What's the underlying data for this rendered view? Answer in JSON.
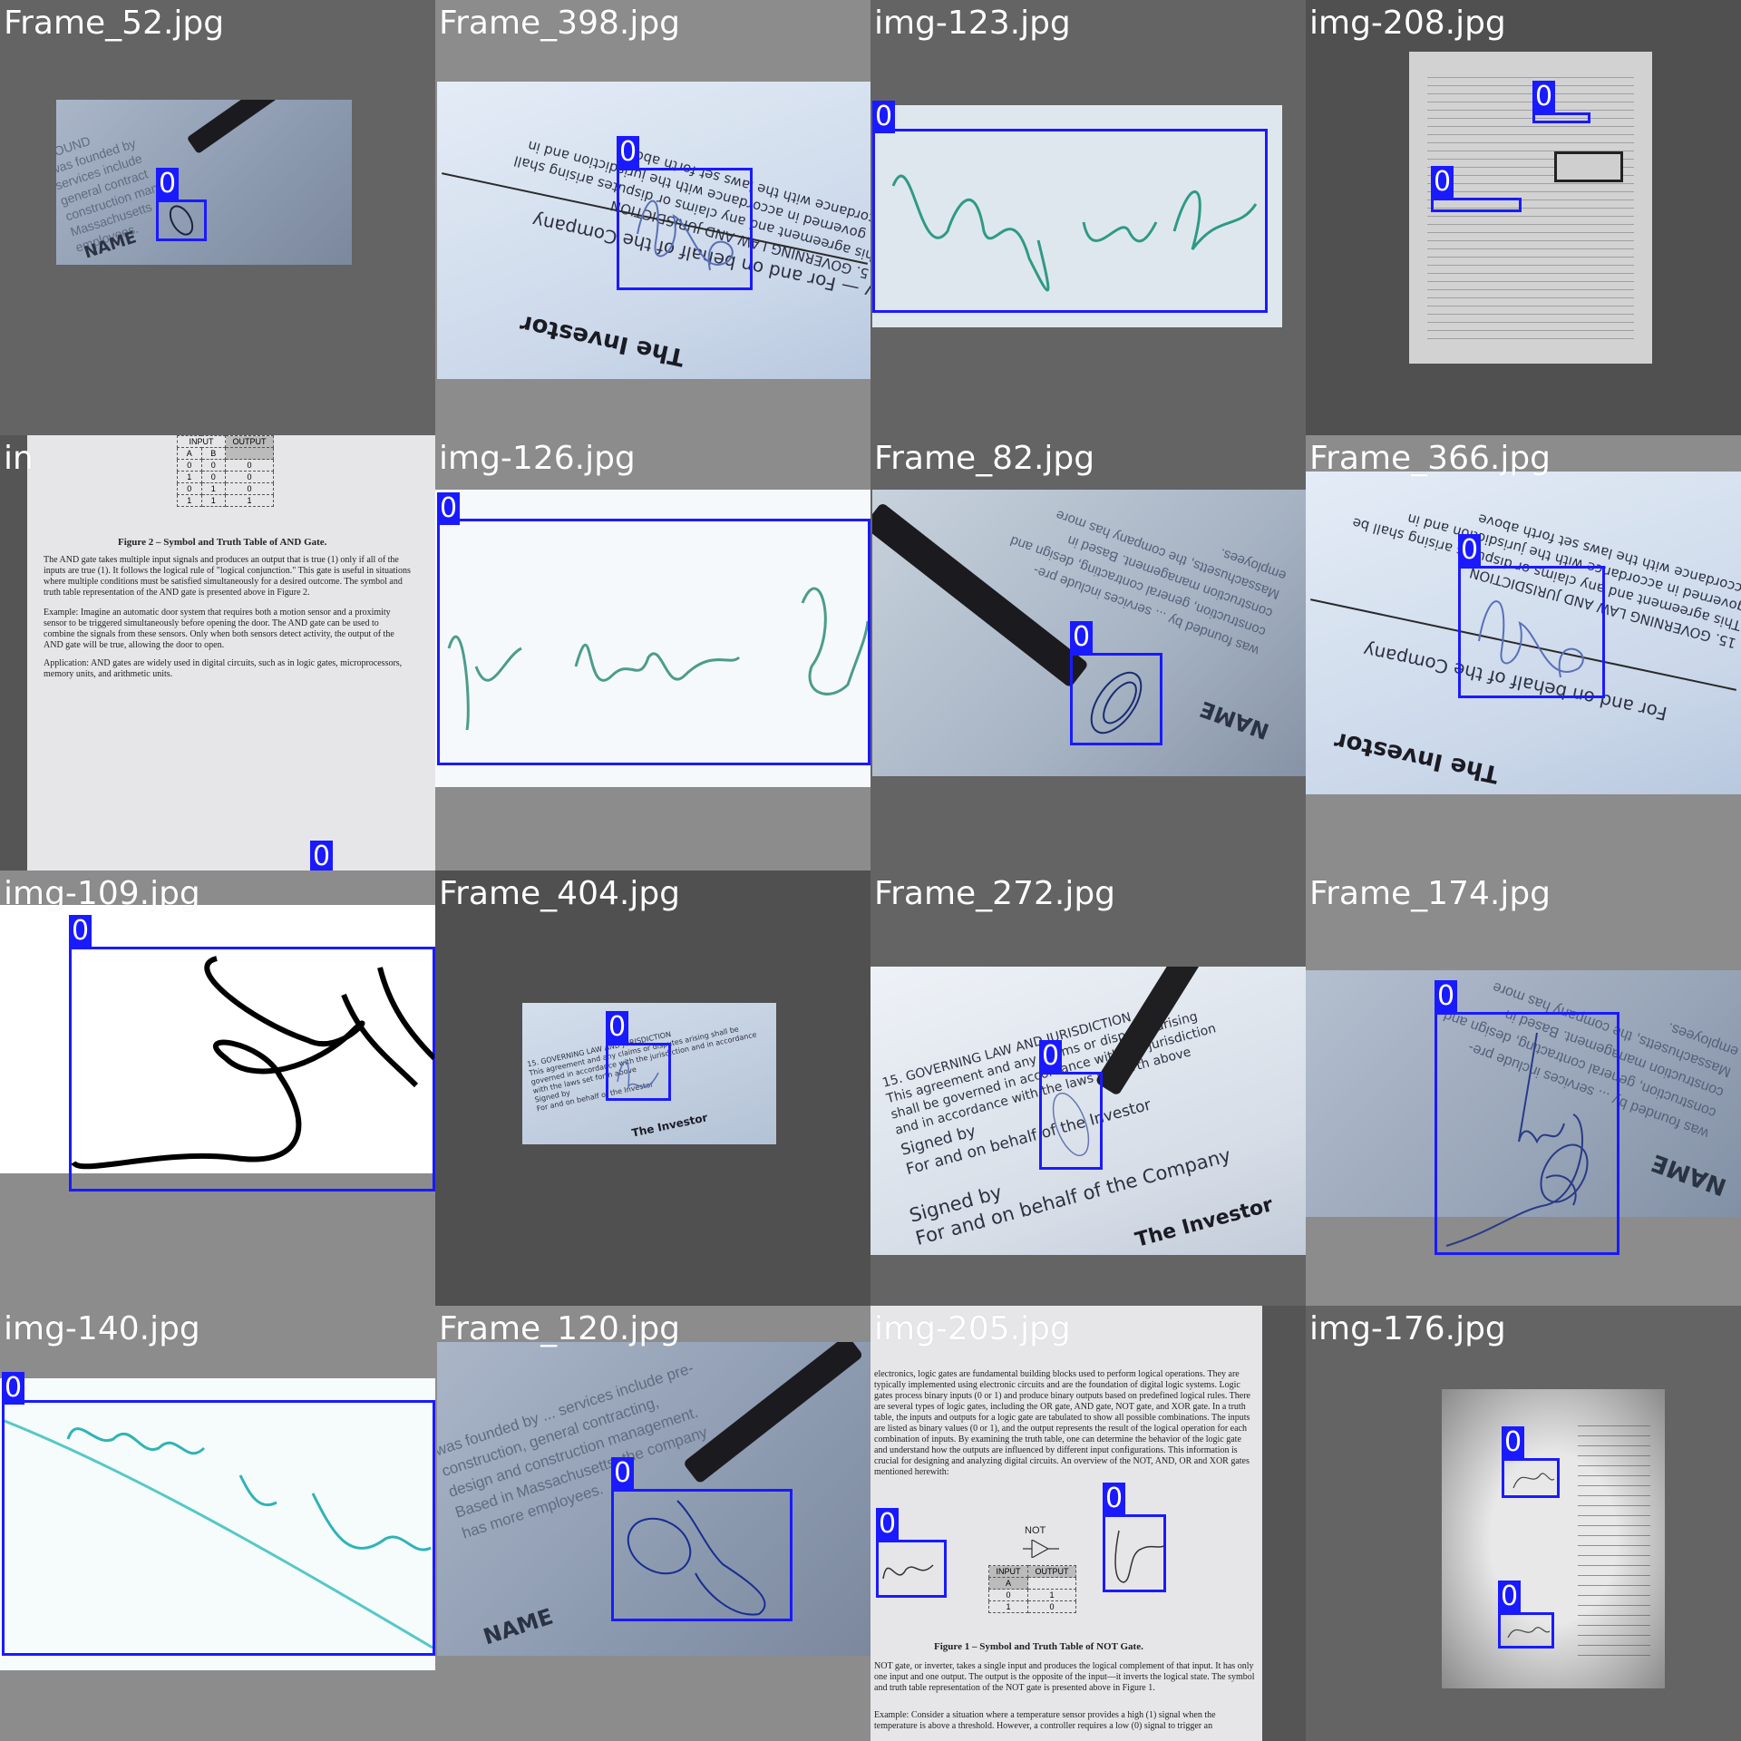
{
  "grid": {
    "tiles": [
      {
        "file": "Frame_52.jpg",
        "label": "0"
      },
      {
        "file": "Frame_398.jpg",
        "label": "0"
      },
      {
        "file": "img-123.jpg",
        "label": "0"
      },
      {
        "file": "img-208.jpg",
        "label": "0"
      },
      {
        "file": "img-xxx",
        "label": "0"
      },
      {
        "file": "img-126.jpg",
        "label": "0"
      },
      {
        "file": "Frame_82.jpg",
        "label": "0"
      },
      {
        "file": "Frame_366.jpg",
        "label": "0"
      },
      {
        "file": "img-109.jpg",
        "label": "0"
      },
      {
        "file": "Frame_404.jpg",
        "label": "0"
      },
      {
        "file": "Frame_272.jpg",
        "label": "0"
      },
      {
        "file": "Frame_174.jpg",
        "label": "0"
      },
      {
        "file": "img-140.jpg",
        "label": "0"
      },
      {
        "file": "Frame_120.jpg",
        "label": "0"
      },
      {
        "file": "img-205.jpg",
        "label": "0"
      },
      {
        "file": "img-176.jpg",
        "label": "0"
      }
    ]
  },
  "tile5": {
    "title": "in"
  },
  "doc5": {
    "table_headers": [
      "INPUT",
      "OUTPUT"
    ],
    "table_sub": [
      "A",
      "B"
    ],
    "rows": [
      [
        "0",
        "0",
        "0"
      ],
      [
        "1",
        "0",
        "0"
      ],
      [
        "0",
        "1",
        "0"
      ],
      [
        "1",
        "1",
        "1"
      ]
    ],
    "caption": "Figure 2 – Symbol and Truth Table of AND Gate.",
    "para1": "The AND gate takes multiple input signals and produces an output that is true (1) only if all of the inputs are true (1). It follows the logical rule of \"logical conjunction.\" This gate is useful in situations where multiple conditions must be satisfied simultaneously for a desired outcome. The symbol and truth table representation of the AND gate is presented above in Figure 2.",
    "para2": "Example: Imagine an automatic door system that requires both a motion sensor and a proximity sensor to be triggered simultaneously before opening the door. The AND gate can be used to combine the signals from these sensors. Only when both sensors detect activity, the output of the AND gate will be true, allowing the door to open.",
    "para3": "Application: AND gates are widely used in digital circuits, such as in logic gates, microprocessors, memory units, and arithmetic units."
  },
  "doc15": {
    "para1": "electronics, logic gates are fundamental building blocks used to perform logical operations. They are typically implemented using electronic circuits and are the foundation of digital logic systems. Logic gates process binary inputs (0 or 1) and produce binary outputs based on predefined logical rules. There are several types of logic gates, including the OR gate, AND gate, NOT gate, and XOR gate. In a truth table, the inputs and outputs for a logic gate are tabulated to show all possible combinations. The inputs are listed as binary values (0 or 1), and the output represents the result of the logical operation for each combination of inputs. By examining the truth table, one can determine the behavior of the logic gate and understand how the outputs are influenced by different input configurations. This information is crucial for designing and analyzing digital circuits. An overview of the NOT, AND, OR and XOR gates mentioned herewith:",
    "gate": "NOT",
    "table_headers": [
      "INPUT",
      "OUTPUT"
    ],
    "table_sub": [
      "A"
    ],
    "rows": [
      [
        "0",
        "1"
      ],
      [
        "1",
        "0"
      ]
    ],
    "caption": "Figure 1 – Symbol and Truth Table of NOT Gate.",
    "para2": "NOT gate, or inverter, takes a single input and produces the logical complement of that input. It has only one input and one output. The output is the opposite of the input—it inverts the logical state. The symbol and truth table representation of the NOT gate is presented above in Figure 1.",
    "para3": "Example: Consider a situation where a temperature sensor provides a high (1) signal when the temperature is above a threshold. However, a controller requires a low (0) signal to trigger an"
  },
  "doc_lines": {
    "governing": "15. GOVERNING LAW AND JURISDICTION",
    "agreement": "This agreement and any claims or disputes arising shall be governed in accordance with the jurisdiction and in accordance with the laws set forth above",
    "signed_by": "Signed by",
    "behalf_investor": "For and on behalf of the Investor",
    "behalf_company": "For and on behalf of the Company",
    "the_investor": "The Investor",
    "name": "NAME",
    "background": "BACKGROUND",
    "bg_text": "was founded by ... services include pre-construction, general contracting, design and construction management. Based in Massachusetts, the company has more employees."
  }
}
